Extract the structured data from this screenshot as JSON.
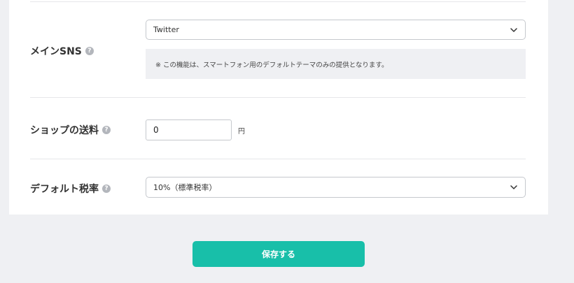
{
  "settings": {
    "main_sns": {
      "label": "メインSNS",
      "help_icon": "question-circle-icon",
      "selected_value": "Twitter",
      "notice": "※ この機能は、スマートフォン用のデフォルトテーマのみの提供となります。"
    },
    "shipping": {
      "label": "ショップの送料",
      "help_icon": "question-circle-icon",
      "value": "0",
      "unit": "円"
    },
    "tax_rate": {
      "label": "デフォルト税率",
      "help_icon": "question-circle-icon",
      "selected_value": "10%（標準税率）"
    }
  },
  "help_glyph": "?",
  "actions": {
    "save_label": "保存する"
  },
  "colors": {
    "page_background": "#eff0f3",
    "card_background": "#ffffff",
    "accent": "#18bfa9",
    "notice_background": "#eff0f3",
    "border": "#c5c8cd"
  }
}
